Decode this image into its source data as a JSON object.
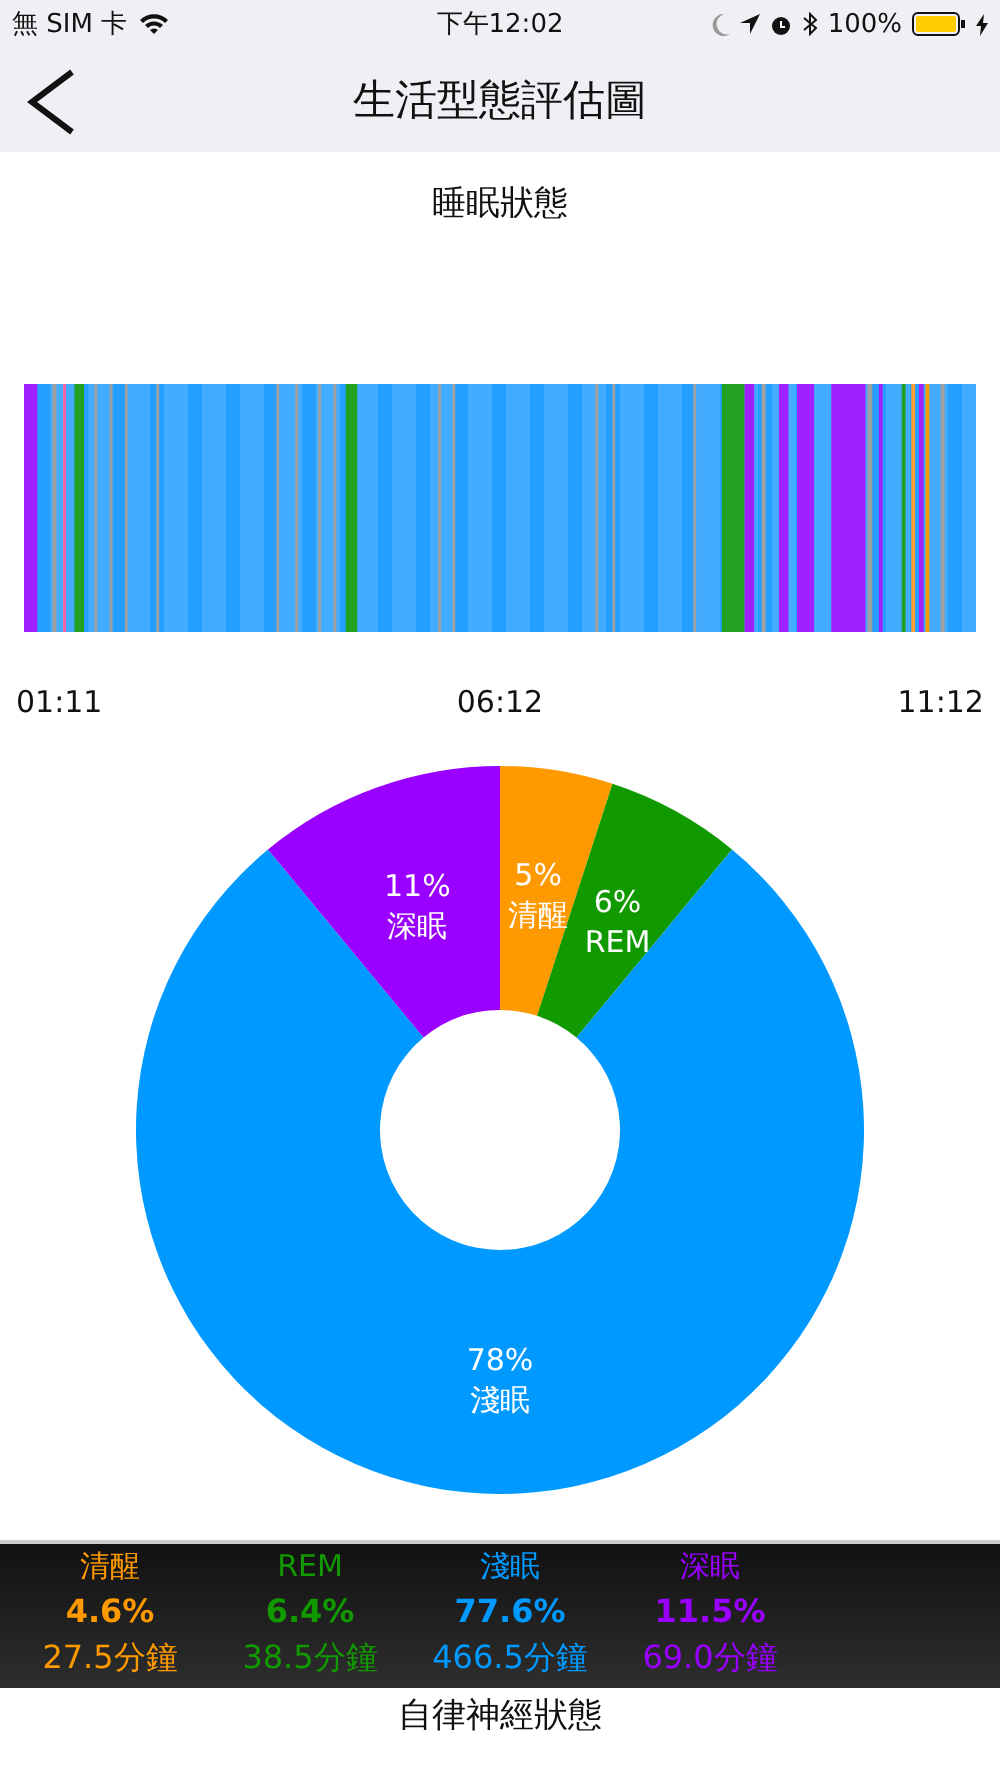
{
  "status_bar": {
    "carrier": "無 SIM 卡",
    "time": "下午12:02",
    "battery": "100%"
  },
  "nav": {
    "title": "生活型態評估圖"
  },
  "sleep": {
    "title": "睡眠狀態",
    "times": [
      "01:11",
      "06:12",
      "11:12"
    ],
    "chart_data": {
      "type": "donut",
      "categories": [
        "清醒",
        "REM",
        "淺眠",
        "深眠"
      ],
      "values": [
        5,
        6,
        78,
        11
      ],
      "value_labels": [
        "5%",
        "6%",
        "78%",
        "11%"
      ],
      "colors": [
        "#ff9900",
        "#119900",
        "#0099ff",
        "#9900ff"
      ]
    }
  },
  "legend": [
    {
      "name": "清醒",
      "percent": "4.6%",
      "minutes": "27.5分鐘",
      "color": "#ff9900"
    },
    {
      "name": "REM",
      "percent": "6.4%",
      "minutes": "38.5分鐘",
      "color": "#119900"
    },
    {
      "name": "淺眠",
      "percent": "77.6%",
      "minutes": "466.5分鐘",
      "color": "#0099ff"
    },
    {
      "name": "深眠",
      "percent": "11.5%",
      "minutes": "69.0分鐘",
      "color": "#9900ff"
    }
  ],
  "next_section": {
    "title": "自律神經狀態"
  }
}
